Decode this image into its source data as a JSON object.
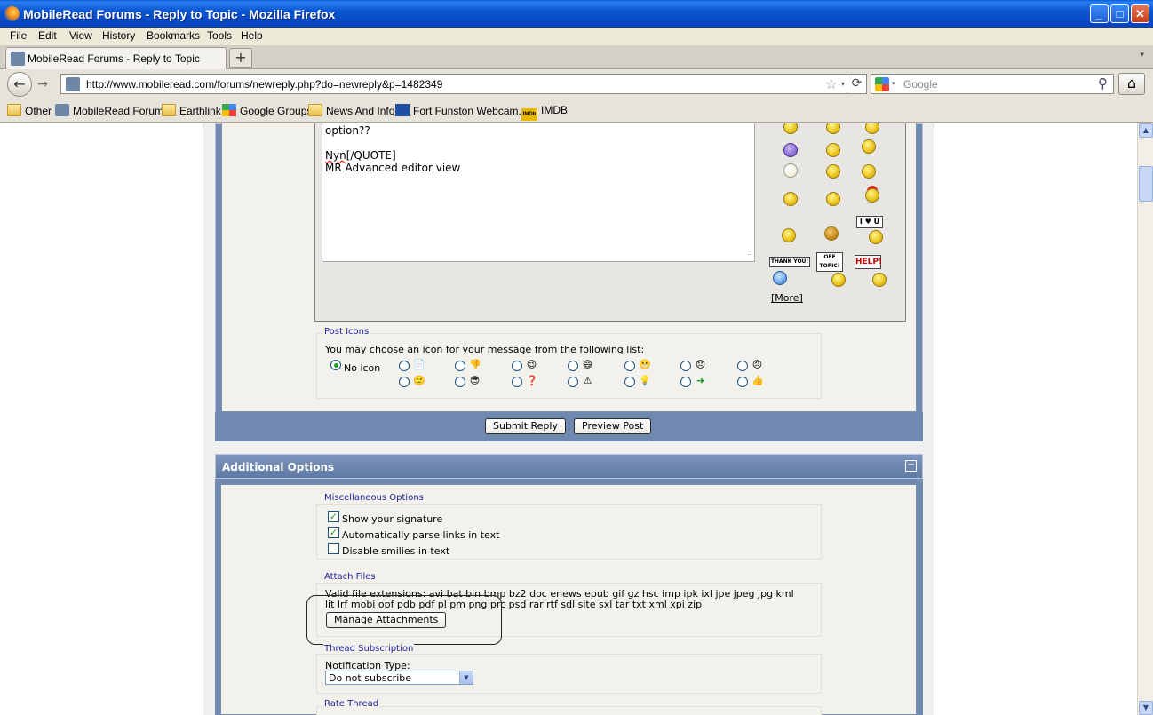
{
  "window": {
    "title": "MobileRead Forums - Reply to Topic - Mozilla Firefox",
    "minimize_label": "_",
    "maximize_label": "□",
    "close_label": "✕"
  },
  "menu": {
    "items": [
      "File",
      "Edit",
      "View",
      "History",
      "Bookmarks",
      "Tools",
      "Help"
    ]
  },
  "tabs": {
    "active_label": "MobileRead Forums - Reply to Topic",
    "new_tab_label": "+",
    "list_label": "▾"
  },
  "nav": {
    "back_label": "←",
    "forward_label": "→",
    "url": "http://www.mobileread.com/forums/newreply.php?do=newreply&p=1482349",
    "star_label": "☆",
    "url_drop_label": "▾",
    "reload_label": "⟳",
    "search_placeholder": "Google",
    "search_drop_label": "▾",
    "search_label": "⚲",
    "home_label": "⌂"
  },
  "bookmarks": [
    "Other",
    "MobileRead Forums",
    "Earthlink",
    "Google Groups",
    "News And Info",
    "Fort Funston Webcam...",
    "IMDB"
  ],
  "imdb_logo": "IMDb",
  "editor": {
    "line1": "option??",
    "line2_underlined": "Nyn",
    "line2_rest": "[/QUOTE]",
    "line3": "MR Advanced editor view",
    "resize_glyph": ".:"
  },
  "smilies": {
    "signs": {
      "love": "I ♥ U",
      "thanks": "THANK YOU!",
      "offtopic": "OFF TOPIC!",
      "help": "HELP!"
    },
    "more_label": "[More]"
  },
  "post_icons": {
    "legend": "Post Icons",
    "instruction": "You may choose an icon for your message from the following list:",
    "no_icon_label": "No icon",
    "row1_icons": [
      "📄",
      "👎",
      "😉",
      "😄",
      "😬",
      "😞",
      "😠"
    ],
    "row2_icons": [
      "🙂",
      "😎",
      "❓",
      "⚠",
      "💡",
      "➜",
      "👍"
    ]
  },
  "buttons": {
    "submit": "Submit Reply",
    "preview": "Preview Post",
    "manage_attachments": "Manage Attachments"
  },
  "additional": {
    "title": "Additional Options",
    "collapse_label": "−",
    "misc_legend": "Miscellaneous Options",
    "options": [
      {
        "label": "Show your signature",
        "checked": true
      },
      {
        "label": "Automatically parse links in text",
        "checked": true
      },
      {
        "label": "Disable smilies in text",
        "checked": false
      }
    ],
    "check_mark": "✓",
    "attach_legend": "Attach Files",
    "extensions_line1": "Valid file extensions: avi bat bin bmp bz2 doc enews epub gif gz hsc imp ipk ixl jpe jpeg jpg kml",
    "extensions_line2": "lit lrf mobi opf pdb pdf pl pm png prc psd rar rtf sdl site sxl tar txt xml xpi zip",
    "subscription_legend": "Thread Subscription",
    "notification_label": "Notification Type:",
    "notification_value": "Do not subscribe",
    "select_arrow": "▼",
    "rate_legend": "Rate Thread"
  },
  "scrollbar": {
    "up": "▲",
    "down": "▼"
  }
}
